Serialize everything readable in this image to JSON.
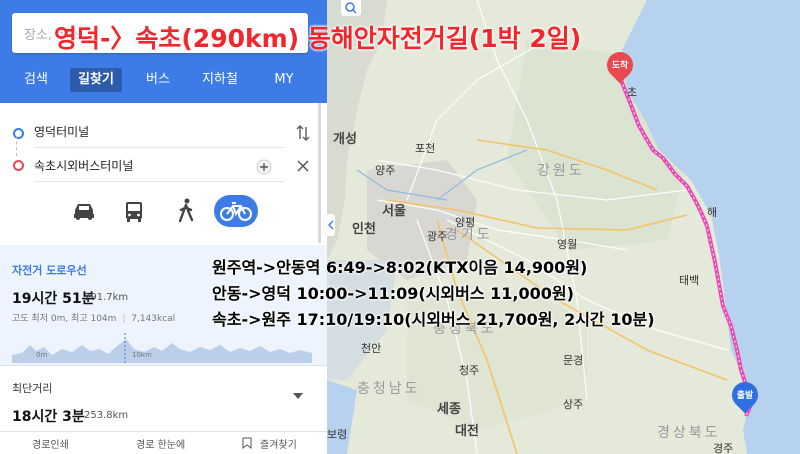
{
  "overlay": {
    "title": "영덕-〉속초(290km) 동해안자전거길(1박 2일)",
    "lines": [
      "원주역->안동역 6:49->8:02(KTX이음 14,900원)",
      "안동->영덕 10:00->11:09(시외버스 11,000원)",
      "속초->원주 17:10/19:10(시외버스 21,700원, 2시간 10분)"
    ]
  },
  "search": {
    "placeholder": "장소, 버스"
  },
  "nav_tabs": [
    {
      "label": "검색",
      "active": false
    },
    {
      "label": "길찾기",
      "active": true
    },
    {
      "label": "버스",
      "active": false
    },
    {
      "label": "지하철",
      "active": false
    },
    {
      "label": "MY",
      "active": false
    }
  ],
  "route": {
    "origin": "영덕터미널",
    "destination": "속초시외버스터미널"
  },
  "modes": [
    {
      "icon": "car-icon",
      "active": false
    },
    {
      "icon": "bus-icon",
      "active": false
    },
    {
      "icon": "walk-icon",
      "active": false
    },
    {
      "icon": "bicycle-icon",
      "active": true
    }
  ],
  "result": {
    "label": "자전거 도로우선",
    "time": "19시간 51분",
    "distance": "291.7km",
    "elevation": "고도 최저 0m, 최고 104m",
    "kcal": "7,143kcal",
    "chart_start": "0m",
    "chart_end": "10km"
  },
  "alt_result": {
    "label": "최단거리",
    "time": "18시간 3분",
    "distance": "253.8km"
  },
  "footer": {
    "print": "경로인쇄",
    "overview": "경로 한눈에",
    "favorite": "즐겨찾기"
  },
  "map": {
    "arrive_badge": "도착",
    "depart_badge": "출발",
    "labels": {
      "gaeseong": "개성",
      "seoul": "서울",
      "incheon": "인천",
      "pocheon": "포천",
      "yangju": "양주",
      "yangpyeong": "양평",
      "gwangju": "광주",
      "yeongwol": "영월",
      "gangwon": "강원도",
      "gyeonggi": "경기도",
      "chungcheongbuk": "충청북도",
      "chungcheongnam": "충청남도",
      "gyeongsangbuk": "경상북도",
      "taebaek": "태백",
      "cheonan": "천안",
      "cheongju": "청주",
      "sejong": "세종",
      "daejeon": "대전",
      "mungyeong": "문경",
      "sangju": "상주",
      "boryeong": "보령",
      "cho": "초",
      "hae": "해",
      "gyeongju": "경주"
    }
  }
}
